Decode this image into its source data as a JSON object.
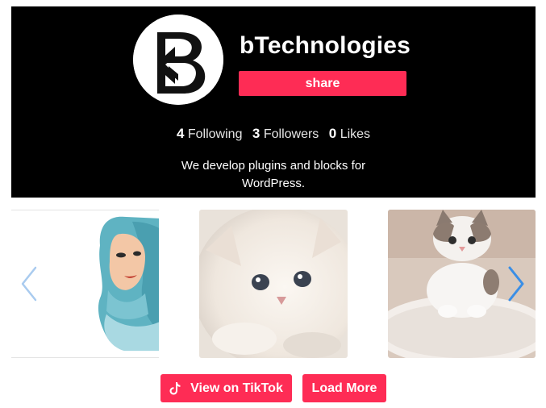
{
  "profile": {
    "username": "bTechnologies",
    "share_label": "share",
    "stats": [
      {
        "value": "4",
        "label": "Following"
      },
      {
        "value": "3",
        "label": "Followers"
      },
      {
        "value": "0",
        "label": "Likes"
      }
    ],
    "bio": "We develop plugins and blocks for WordPress."
  },
  "carousel": {
    "videos": [
      {
        "thumbnail": "hijab-illustration-thumbnail"
      },
      {
        "thumbnail": "fluffy-white-kitten-thumbnail"
      },
      {
        "thumbnail": "white-kitten-on-rug-thumbnail"
      }
    ],
    "prev_icon": "chevron-left-icon",
    "next_icon": "chevron-right-icon"
  },
  "actions": {
    "view_label": "View on TikTok",
    "view_icon": "tiktok-icon",
    "load_more_label": "Load More"
  },
  "colors": {
    "accent": "#fe2c55",
    "header_bg": "#000000",
    "arrow": "#3a8ee6"
  }
}
